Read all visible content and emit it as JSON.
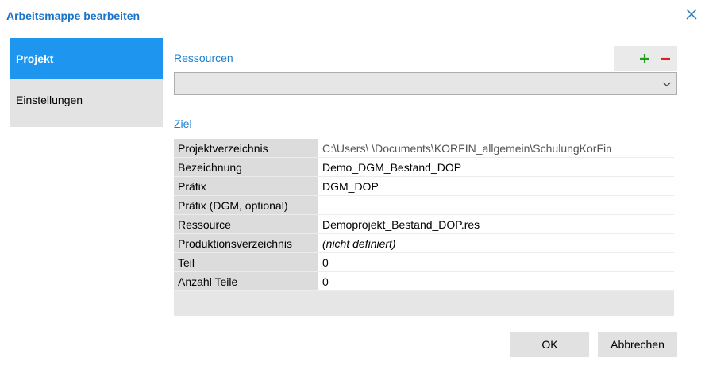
{
  "window": {
    "title": "Arbeitsmappe bearbeiten"
  },
  "icons": {
    "close": "close-icon",
    "add": "plus-icon",
    "remove": "minus-icon",
    "dropdown": "chevron-down-icon"
  },
  "colors": {
    "accent": "#1e96f0",
    "title": "#1a73c7",
    "add": "#1e9e1e",
    "remove": "#e02020"
  },
  "nav": {
    "items": [
      {
        "label": "Projekt",
        "active": true
      },
      {
        "label": "Einstellungen",
        "active": false
      }
    ]
  },
  "resources": {
    "label": "Ressourcen",
    "selected": ""
  },
  "target": {
    "label": "Ziel",
    "rows": [
      {
        "label": "Projektverzeichnis",
        "value": "C:\\Users\\                \\Documents\\KORFIN_allgemein\\SchulungKorFin"
      },
      {
        "label": "Bezeichnung",
        "value": "Demo_DGM_Bestand_DOP"
      },
      {
        "label": "Präfix",
        "value": "DGM_DOP"
      },
      {
        "label": "Präfix (DGM, optional)",
        "value": ""
      },
      {
        "label": "Ressource",
        "value": "Demoprojekt_Bestand_DOP.res"
      },
      {
        "label": "Produktionsverzeichnis",
        "value": "(nicht definiert)"
      },
      {
        "label": "Teil",
        "value": "0"
      },
      {
        "label": "Anzahl Teile",
        "value": "0"
      }
    ]
  },
  "buttons": {
    "ok": "OK",
    "cancel": "Abbrechen"
  }
}
